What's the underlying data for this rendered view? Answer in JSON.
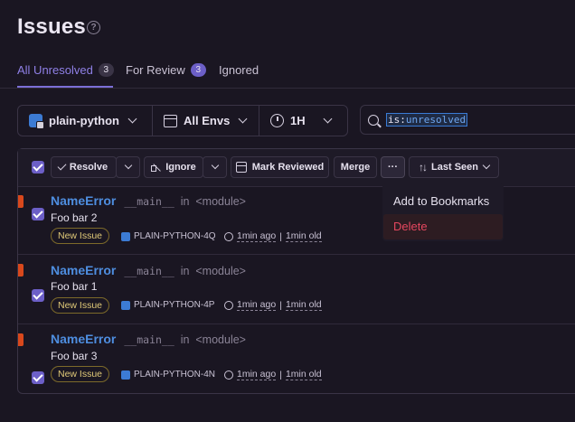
{
  "page": {
    "title": "Issues",
    "help_glyph": "?"
  },
  "tabs": [
    {
      "label": "All Unresolved",
      "count": "3",
      "active": true
    },
    {
      "label": "For Review",
      "count": "3"
    },
    {
      "label": "Ignored"
    }
  ],
  "filters": {
    "project": "plain-python",
    "environment": "All Envs",
    "period": "1H"
  },
  "search": {
    "query_key": "is:",
    "query_value": "unresolved"
  },
  "actions": {
    "resolve": "Resolve",
    "ignore": "Ignore",
    "mark_reviewed": "Mark Reviewed",
    "merge": "Merge",
    "more": "···",
    "sort": "Last Seen"
  },
  "more_menu": {
    "add_to_bookmarks": "Add to Bookmarks",
    "delete": "Delete"
  },
  "issues": [
    {
      "type": "NameError",
      "culprit_func": "__main__",
      "culprit_in": "in",
      "culprit_loc": "<module>",
      "message": "Foo bar 2",
      "badge": "New Issue",
      "short_id": "PLAIN-PYTHON-4Q",
      "last_seen": "1min ago",
      "first_seen": "1min old"
    },
    {
      "type": "NameError",
      "culprit_func": "__main__",
      "culprit_in": "in",
      "culprit_loc": "<module>",
      "message": "Foo bar 1",
      "badge": "New Issue",
      "short_id": "PLAIN-PYTHON-4P",
      "last_seen": "1min ago",
      "first_seen": "1min old"
    },
    {
      "type": "NameError",
      "culprit_func": "__main__",
      "culprit_in": "in",
      "culprit_loc": "<module>",
      "message": "Foo bar 3",
      "badge": "New Issue",
      "short_id": "PLAIN-PYTHON-4N",
      "last_seen": "1min ago",
      "first_seen": "1min old"
    }
  ],
  "colors": {
    "accent": "#6c5fc7",
    "error_level": "#d8481c",
    "link": "#4e8ee0",
    "danger": "#e5475f"
  }
}
